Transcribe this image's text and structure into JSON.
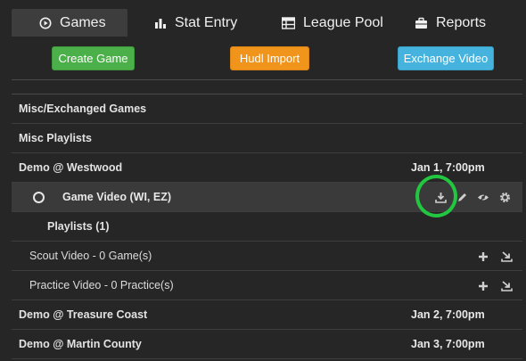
{
  "tabs": [
    {
      "label": "Games",
      "icon": "play-circle-icon",
      "active": true
    },
    {
      "label": "Stat Entry",
      "icon": "bar-chart-icon"
    },
    {
      "label": "League Pool",
      "icon": "grid-list-icon"
    },
    {
      "label": "Reports",
      "icon": "briefcase-icon"
    }
  ],
  "buttons": {
    "create_game": "Create Game",
    "hudl_import": "Hudl Import",
    "exchange_video": "Exchange Video"
  },
  "list": {
    "misc_exchanged": "Misc/Exchanged Games",
    "misc_playlists": "Misc Playlists",
    "games": [
      {
        "title": "Demo @ Westwood",
        "date": "Jan 1, 7:00pm"
      },
      {
        "title": "Demo @ Treasure Coast",
        "date": "Jan 2, 7:00pm"
      },
      {
        "title": "Demo @ Martin County",
        "date": "Jan 3, 7:00pm"
      }
    ],
    "game_video": "Game Video (WI, EZ)",
    "playlists_heading": "Playlists (1)",
    "playlists": [
      {
        "label": "Scout Video - 0 Game(s)"
      },
      {
        "label": "Practice Video - 0 Practice(s)"
      }
    ]
  },
  "colors": {
    "create": "#4cb04a",
    "hudl": "#f0941c",
    "exchange": "#45b3dd",
    "highlight": "#22c640"
  }
}
